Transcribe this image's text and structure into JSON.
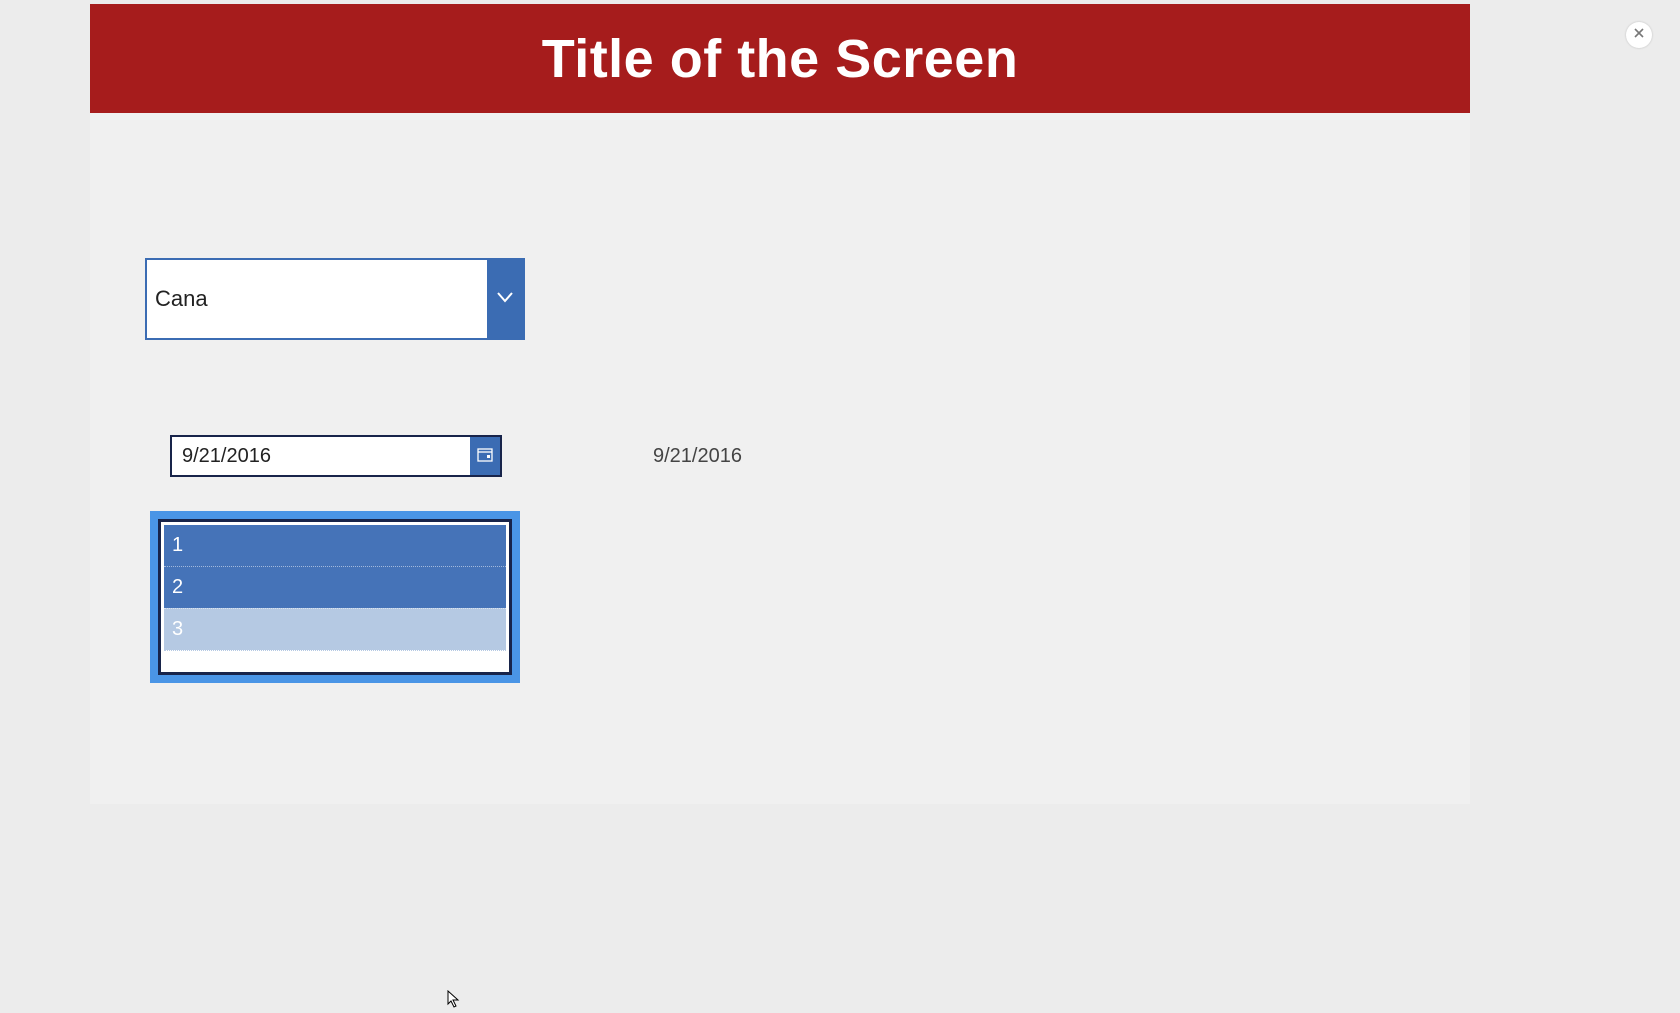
{
  "header": {
    "title": "Title of the Screen"
  },
  "combobox": {
    "value": "Cana"
  },
  "datepicker": {
    "value": "9/21/2016"
  },
  "label": {
    "date_text": "9/21/2016"
  },
  "listbox": {
    "items": [
      "1",
      "2",
      "3"
    ]
  },
  "colors": {
    "header_bg": "#a61c1c",
    "accent_blue": "#3b6cb3",
    "focus_blue": "#4a95e6",
    "dark_navy": "#18244a",
    "listitem_light": "#b5c9e3"
  }
}
